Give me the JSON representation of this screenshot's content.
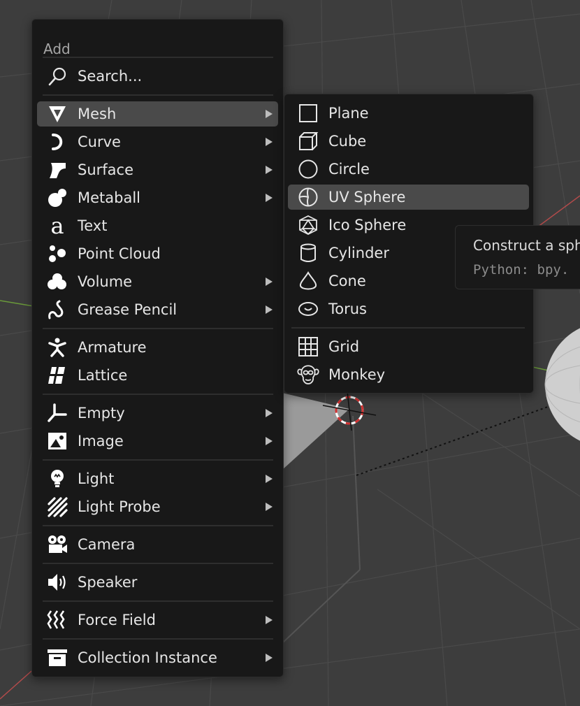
{
  "add_menu": {
    "title": "Add",
    "items": [
      {
        "label": "Search...",
        "icon": "search-icon",
        "submenu": false
      },
      {
        "label": "Mesh",
        "icon": "mesh-icon",
        "submenu": true,
        "active": true
      },
      {
        "label": "Curve",
        "icon": "curve-icon",
        "submenu": true
      },
      {
        "label": "Surface",
        "icon": "surface-icon",
        "submenu": true
      },
      {
        "label": "Metaball",
        "icon": "metaball-icon",
        "submenu": true
      },
      {
        "label": "Text",
        "icon": "text-icon",
        "submenu": false
      },
      {
        "label": "Point Cloud",
        "icon": "point-cloud-icon",
        "submenu": false
      },
      {
        "label": "Volume",
        "icon": "volume-icon",
        "submenu": true
      },
      {
        "label": "Grease Pencil",
        "icon": "grease-pencil-icon",
        "submenu": true
      },
      {
        "label": "Armature",
        "icon": "armature-icon",
        "submenu": false
      },
      {
        "label": "Lattice",
        "icon": "lattice-icon",
        "submenu": false
      },
      {
        "label": "Empty",
        "icon": "empty-icon",
        "submenu": true
      },
      {
        "label": "Image",
        "icon": "image-icon",
        "submenu": true
      },
      {
        "label": "Light",
        "icon": "light-icon",
        "submenu": true
      },
      {
        "label": "Light Probe",
        "icon": "light-probe-icon",
        "submenu": true
      },
      {
        "label": "Camera",
        "icon": "camera-icon",
        "submenu": false
      },
      {
        "label": "Speaker",
        "icon": "speaker-icon",
        "submenu": false
      },
      {
        "label": "Force Field",
        "icon": "force-field-icon",
        "submenu": true
      },
      {
        "label": "Collection Instance",
        "icon": "collection-instance-icon",
        "submenu": true
      }
    ]
  },
  "mesh_submenu": {
    "items": [
      {
        "label": "Plane",
        "icon": "plane-icon"
      },
      {
        "label": "Cube",
        "icon": "cube-icon"
      },
      {
        "label": "Circle",
        "icon": "circle-icon"
      },
      {
        "label": "UV Sphere",
        "icon": "uv-sphere-icon",
        "active": true
      },
      {
        "label": "Ico Sphere",
        "icon": "ico-sphere-icon"
      },
      {
        "label": "Cylinder",
        "icon": "cylinder-icon"
      },
      {
        "label": "Cone",
        "icon": "cone-icon"
      },
      {
        "label": "Torus",
        "icon": "torus-icon"
      },
      {
        "label": "Grid",
        "icon": "grid-icon"
      },
      {
        "label": "Monkey",
        "icon": "monkey-icon"
      }
    ]
  },
  "tooltip": {
    "description": "Construct a sph",
    "python": "Python: bpy."
  },
  "colors": {
    "menu_bg": "#181818",
    "highlight": "#4a4a4a",
    "text": "#e6e6e6",
    "viewport_bg": "#3d3d3d",
    "x_axis": "#b34b4b",
    "y_axis": "#6a9a3a"
  }
}
